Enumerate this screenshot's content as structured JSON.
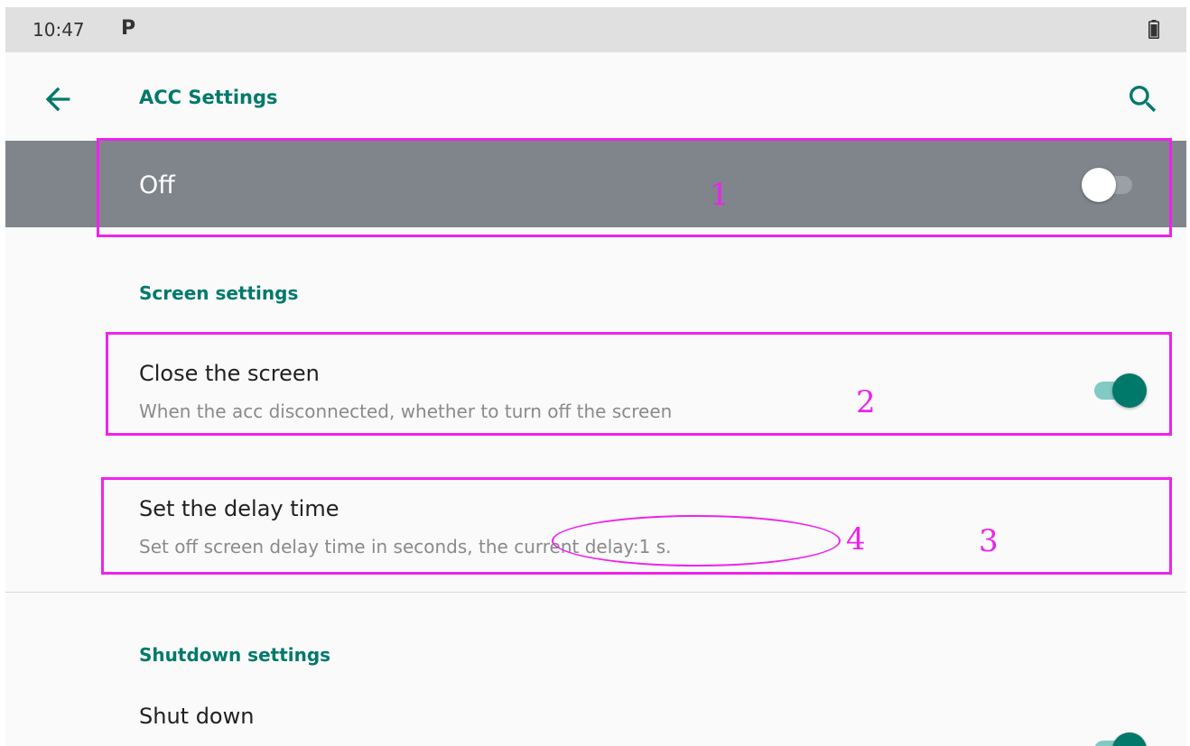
{
  "status_bar": {
    "time": "10:47",
    "notification_icon": "P",
    "battery_icon": "battery-icon"
  },
  "app_bar": {
    "title": "ACC Settings",
    "back_icon": "arrow-back-icon",
    "search_icon": "search-icon"
  },
  "master_switch": {
    "label": "Off",
    "checked": false
  },
  "screen_settings": {
    "header": "Screen settings",
    "close_screen": {
      "title": "Close the screen",
      "summary": "When the acc disconnected, whether to turn off the screen",
      "checked": true
    },
    "delay_time": {
      "title": "Set the delay time",
      "summary": "Set off screen delay time in seconds, the current delay:1 s."
    }
  },
  "shutdown_settings": {
    "header": "Shutdown settings",
    "shut_down": {
      "title": "Shut down",
      "checked": true
    }
  },
  "annotations": {
    "label_1": "1",
    "label_2": "2",
    "label_3": "3",
    "label_4": "4"
  },
  "colors": {
    "accent": "#00796b",
    "annotation": "#ee22ee",
    "master_bar": "#7f858b"
  }
}
